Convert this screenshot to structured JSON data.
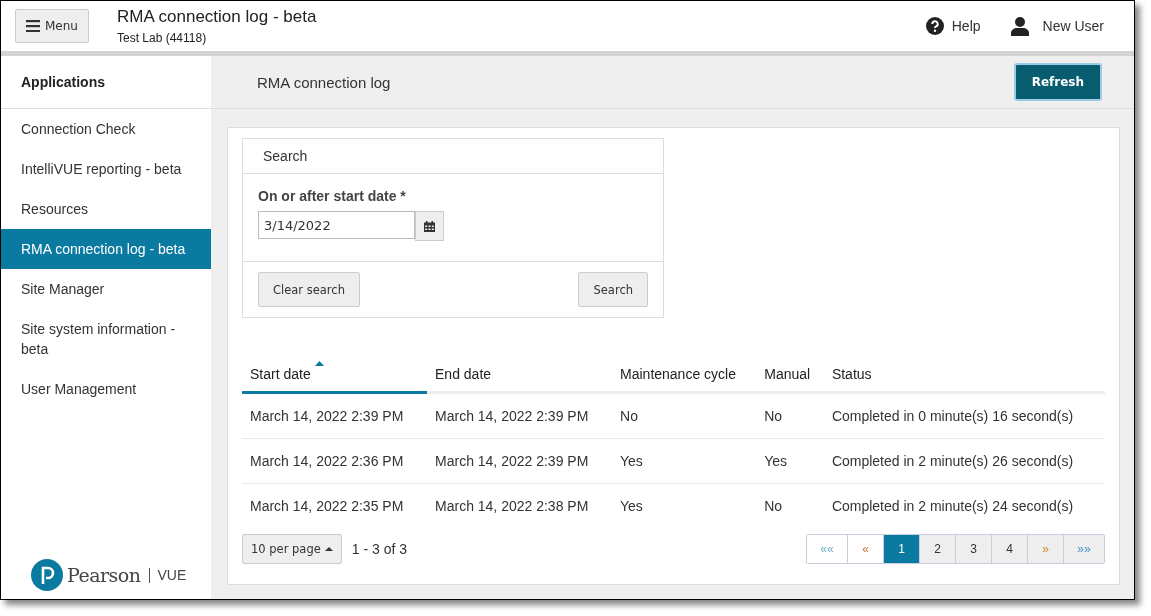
{
  "header": {
    "menu_label": "Menu",
    "title": "RMA connection log - beta",
    "subtitle": "Test Lab (44118)",
    "help": "Help",
    "user": "New User"
  },
  "sidebar": {
    "heading": "Applications",
    "items": [
      {
        "label": "Connection Check",
        "selected": false
      },
      {
        "label": "IntelliVUE reporting - beta",
        "selected": false
      },
      {
        "label": "Resources",
        "selected": false
      },
      {
        "label": "RMA connection log - beta",
        "selected": true
      },
      {
        "label": "Site Manager",
        "selected": false
      },
      {
        "label": "Site system information - beta",
        "selected": false
      },
      {
        "label": "User Management",
        "selected": false
      }
    ],
    "logo": {
      "brand": "Pearson",
      "product": "VUE"
    }
  },
  "page": {
    "title": "RMA connection log",
    "refresh": "Refresh"
  },
  "search": {
    "title": "Search",
    "field_label": "On or after start date *",
    "value": "3/14/2022",
    "clear": "Clear search",
    "submit": "Search"
  },
  "table": {
    "columns": [
      {
        "label": "Start date",
        "sorted": true
      },
      {
        "label": "End date",
        "sorted": false
      },
      {
        "label": "Maintenance cycle",
        "sorted": false
      },
      {
        "label": "Manual",
        "sorted": false
      },
      {
        "label": "Status",
        "sorted": false
      }
    ],
    "rows": [
      [
        "March 14, 2022 2:39 PM",
        "March 14, 2022 2:39 PM",
        "No",
        "No",
        "Completed in 0 minute(s) 16 second(s)"
      ],
      [
        "March 14, 2022 2:36 PM",
        "March 14, 2022 2:39 PM",
        "Yes",
        "Yes",
        "Completed in 2 minute(s) 26 second(s)"
      ],
      [
        "March 14, 2022 2:35 PM",
        "March 14, 2022 2:38 PM",
        "Yes",
        "No",
        "Completed in 2 minute(s) 24 second(s)"
      ]
    ]
  },
  "pagination": {
    "per_page": "10 per page",
    "range": "1 - 3 of 3",
    "pages": [
      {
        "label": "««",
        "kind": "first",
        "selected": false
      },
      {
        "label": "«",
        "kind": "prev",
        "selected": false
      },
      {
        "label": "1",
        "kind": "page",
        "selected": true
      },
      {
        "label": "2",
        "kind": "page",
        "selected": false
      },
      {
        "label": "3",
        "kind": "page",
        "selected": false
      },
      {
        "label": "4",
        "kind": "page",
        "selected": false
      },
      {
        "label": "»",
        "kind": "next",
        "selected": false
      },
      {
        "label": "»»",
        "kind": "last",
        "selected": false
      }
    ]
  }
}
